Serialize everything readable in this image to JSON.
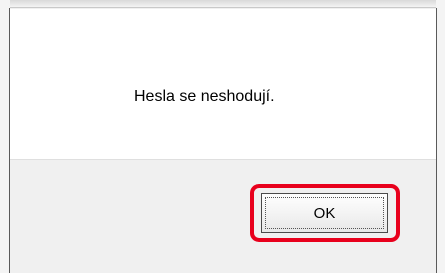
{
  "dialog": {
    "message": "Hesla se neshodují.",
    "ok_label": "OK"
  },
  "colors": {
    "highlight": "#e8001c",
    "message_background": "#ffffff",
    "button_area_background": "#f0f0f0"
  }
}
